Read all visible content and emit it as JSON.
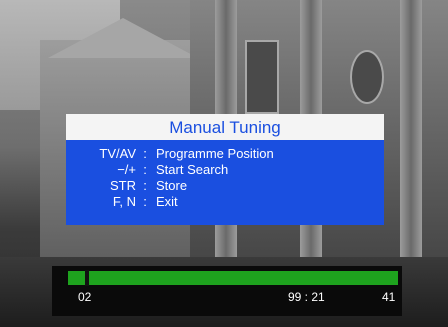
{
  "dialog": {
    "title": "Manual Tuning",
    "items": [
      {
        "key": "TV/AV",
        "sep": ":",
        "desc": "Programme Position"
      },
      {
        "key": "−/+",
        "sep": ":",
        "desc": "Start Search"
      },
      {
        "key": "STR",
        "sep": ":",
        "desc": "Store"
      },
      {
        "key": "F, N",
        "sep": ":",
        "desc": "Exit"
      }
    ]
  },
  "status_bar": {
    "channel": "02",
    "frequency": "99 : 21",
    "value": "41",
    "progress": 0.05
  },
  "colors": {
    "panel_blue": "#1a4fe0",
    "title_bg": "#f4f4f4",
    "track_green": "#1ea31e"
  }
}
